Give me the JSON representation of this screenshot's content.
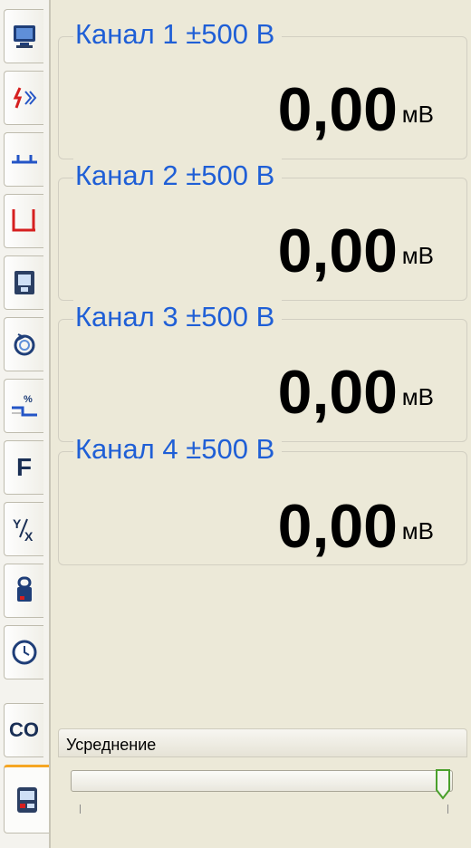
{
  "tabs": [
    {
      "icon": "monitor-icon"
    },
    {
      "icon": "switch-arrows-icon"
    },
    {
      "icon": "pulse-low-icon"
    },
    {
      "icon": "pulse-high-icon"
    },
    {
      "icon": "device-icon"
    },
    {
      "icon": "rotate-icon"
    },
    {
      "icon": "percent-signal-icon"
    },
    {
      "icon": "frequency-icon",
      "label": "F"
    },
    {
      "icon": "ratio-icon",
      "label": "Y/X"
    },
    {
      "icon": "probe-icon"
    },
    {
      "icon": "clock-icon"
    },
    {
      "icon": "co-icon",
      "label": "CO"
    },
    {
      "icon": "meter-icon",
      "active": true
    }
  ],
  "channels": [
    {
      "title": "Канал 1 ±500 В",
      "value": "0,00",
      "unit": "мВ"
    },
    {
      "title": "Канал 2 ±500 В",
      "value": "0,00",
      "unit": "мВ"
    },
    {
      "title": "Канал 3 ±500 В",
      "value": "0,00",
      "unit": "мВ"
    },
    {
      "title": "Канал 4 ±500 В",
      "value": "0,00",
      "unit": "мВ"
    }
  ],
  "averaging": {
    "label": "Усреднение",
    "level_fraction": 1.0
  },
  "colors": {
    "channel_title": "#1f5fd6",
    "accent_tab": "#f5a623",
    "background": "#ece9d8"
  }
}
